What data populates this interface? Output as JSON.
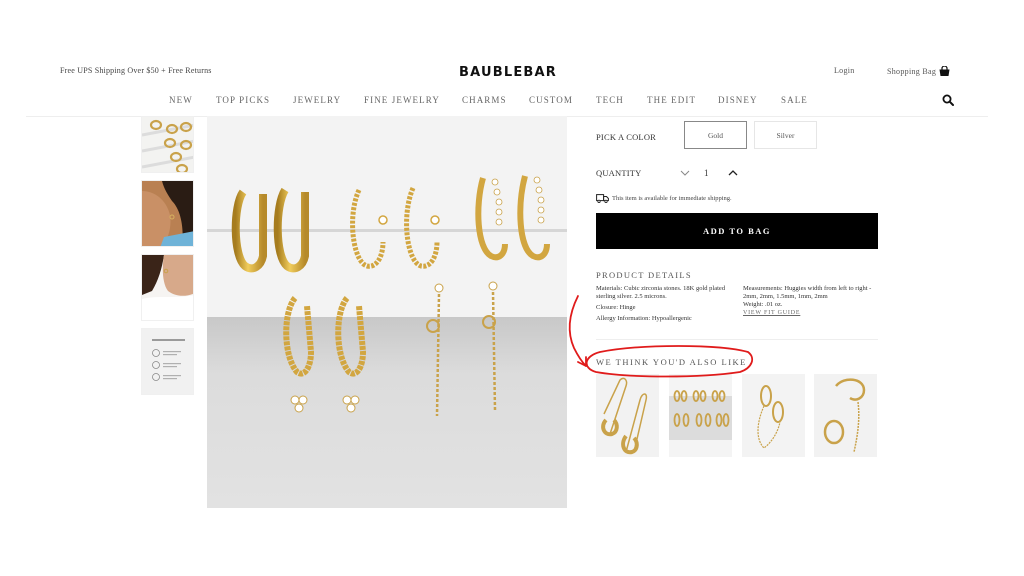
{
  "header": {
    "promo": "Free UPS Shipping Over $50 + Free Returns",
    "logo": "BAUBLEBAR",
    "login": "Login",
    "bag": "Shopping Bag",
    "bag_icon": "shopping-bag-icon",
    "search_icon": "search-icon"
  },
  "nav": {
    "items": [
      "NEW",
      "TOP PICKS",
      "JEWELRY",
      "FINE JEWELRY",
      "CHARMS",
      "CUSTOM",
      "TECH",
      "THE EDIT",
      "DISNEY",
      "SALE"
    ]
  },
  "gallery": {
    "thumbnails": [
      {
        "alt": "Hoops on white ledge"
      },
      {
        "alt": "Model wearing huggies, blue shirt"
      },
      {
        "alt": "Model wearing huggies, white ruffled top"
      },
      {
        "alt": "Caring for your fine jewelry card"
      }
    ],
    "main_alt": "Set of five pairs of gold huggie earrings"
  },
  "product": {
    "pick_color_label": "PICK A COLOR",
    "colors": [
      {
        "label": "Gold",
        "selected": true
      },
      {
        "label": "Silver",
        "selected": false
      }
    ],
    "quantity_label": "QUANTITY",
    "quantity": "1",
    "shipping_note": "This item is available for immediate shipping.",
    "add_to_bag": "ADD TO BAG"
  },
  "details": {
    "title": "PRODUCT DETAILS",
    "materials": "Materials: Cubic zirconia stones. 18K gold plated sterling silver. 2.5 microns.",
    "closure": "Closure: Hinge",
    "allergy": "Allergy Information: Hypoallergenic",
    "measurements": "Measurements: Huggies width from left to right - 2mm, 2mm, 1.5mm, 1mm, 2mm",
    "weight": "Weight: .01 oz.",
    "fit_guide": "VIEW FIT GUIDE"
  },
  "recommendations": {
    "title": "WE THINK YOU'D ALSO LIKE",
    "items": [
      {
        "alt": "Gold safety pin earrings"
      },
      {
        "alt": "Huggie earring set"
      },
      {
        "alt": "Chain-linked double huggies"
      },
      {
        "alt": "Gold ear cuff with chain"
      }
    ]
  },
  "annotation": {
    "color": "#e01b1b"
  }
}
